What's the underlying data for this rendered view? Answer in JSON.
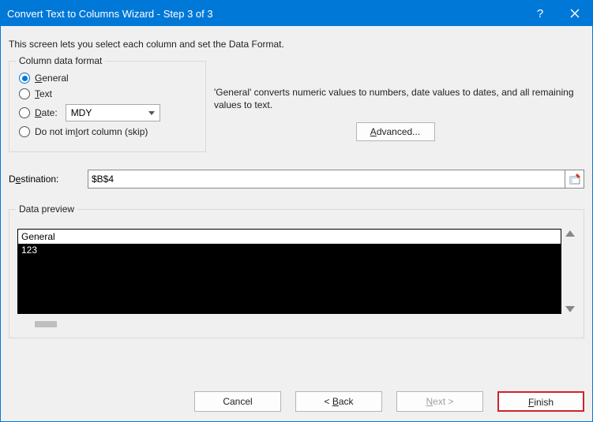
{
  "titlebar": {
    "title": "Convert Text to Columns Wizard - Step 3 of 3"
  },
  "intro": "This screen lets you select each column and set the Data Format.",
  "column_format": {
    "legend": "Column data format",
    "options": {
      "general": "General",
      "text": "Text",
      "date": "Date:",
      "skip": "Do not import column (skip)"
    },
    "date_value": "MDY",
    "selected": "general"
  },
  "general_note": "'General' converts numeric values to numbers, date values to dates, and all remaining values to text.",
  "advanced_label": "Advanced...",
  "destination": {
    "label": "Destination:",
    "value": "$B$4"
  },
  "preview": {
    "legend": "Data preview",
    "header": "General",
    "rows": [
      "123"
    ]
  },
  "buttons": {
    "cancel": "Cancel",
    "back": "< Back",
    "next": "Next >",
    "finish": "Finish"
  },
  "underlines": {
    "general": "G",
    "text": "T",
    "date": "D",
    "skip": "I",
    "advanced": "A",
    "destination": "e",
    "back": "B",
    "next": "N",
    "finish": "F"
  }
}
